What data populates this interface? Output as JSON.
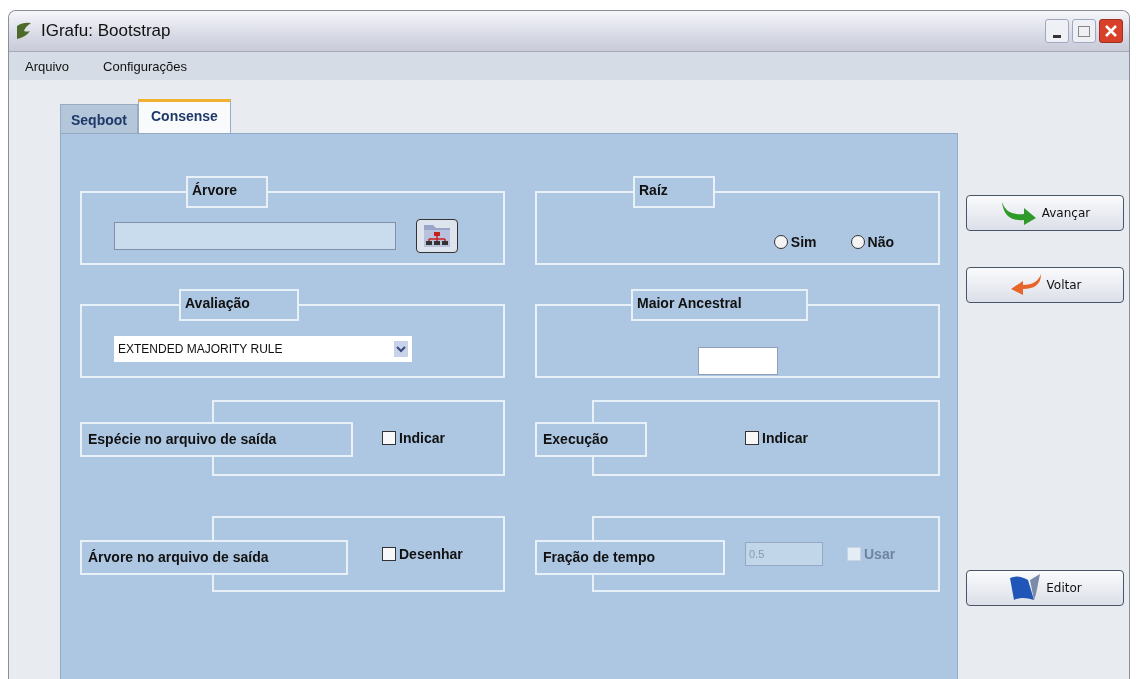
{
  "window": {
    "title": "IGrafu: Bootstrap"
  },
  "menu": [
    "Arquivo",
    "Configurações"
  ],
  "tabs": [
    {
      "label": "Seqboot",
      "selected": false
    },
    {
      "label": "Consense",
      "selected": true
    }
  ],
  "tree_group": {
    "title": "Árvore"
  },
  "root_group": {
    "title": "Raíz",
    "options": [
      {
        "label": "Sim",
        "selected": false
      },
      {
        "label": "Não",
        "selected": false
      }
    ]
  },
  "evaluation_group": {
    "title": "Avaliação",
    "value": "EXTENDED MAJORITY RULE"
  },
  "ancestor_group": {
    "title": "Maior Ancestral"
  },
  "option_rows": [
    {
      "title": "Espécie no arquivo de saída",
      "checkbox": {
        "label": "Indicar",
        "checked": false,
        "disabled": false
      }
    },
    {
      "title": "Execução",
      "checkbox": {
        "label": "Indicar",
        "checked": false,
        "disabled": false
      }
    },
    {
      "title": "Árvore no arquivo de saída",
      "checkbox": {
        "label": "Desenhar",
        "checked": false,
        "disabled": false
      }
    },
    {
      "title": "Fração de tempo",
      "value": "0.5",
      "disabled": true,
      "checkbox": {
        "label": "Usar",
        "checked": false,
        "disabled": true
      }
    }
  ],
  "buttons": [
    {
      "label": "Avançar",
      "kind": "forward"
    },
    {
      "label": "Voltar",
      "kind": "back"
    },
    {
      "label": "Editor",
      "kind": "editor"
    }
  ]
}
